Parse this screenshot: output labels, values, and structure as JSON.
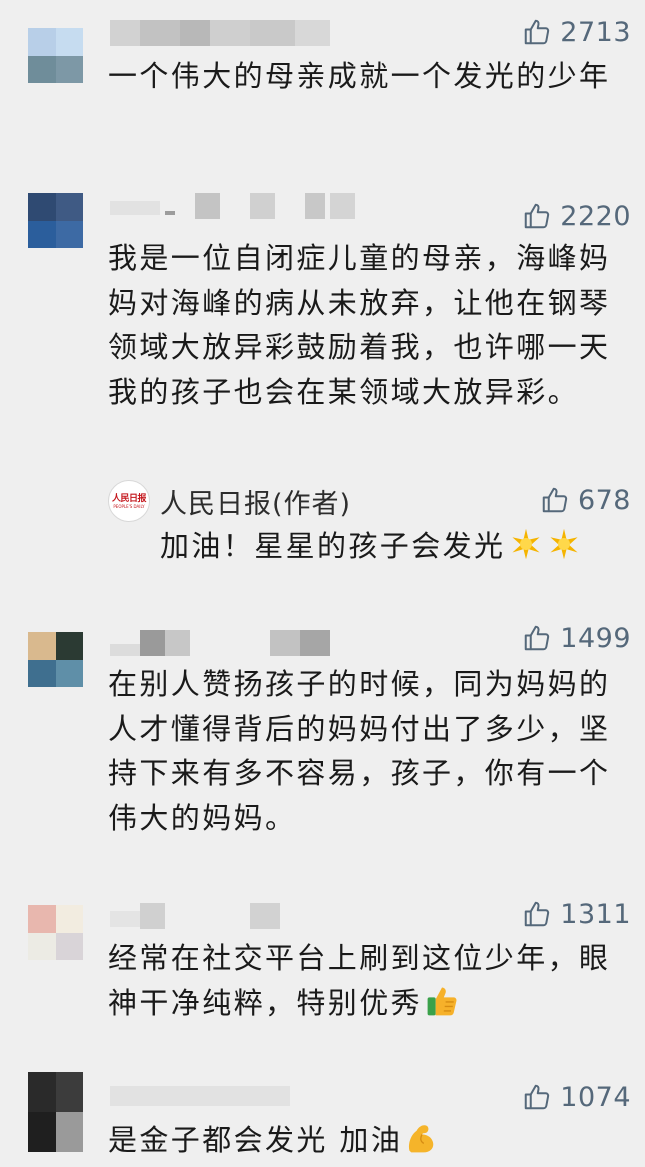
{
  "comments": [
    {
      "likes": "2713",
      "text": "一个伟大的母亲成就一个发光的少年",
      "avatar_colors": [
        "#b8cfe8",
        "#c6dcf0",
        "#6f8d9a",
        "#7d98a6"
      ]
    },
    {
      "likes": "2220",
      "text": "我是一位自闭症儿童的母亲，海峰妈妈对海峰的病从未放弃，让他在钢琴领域大放异彩鼓励着我，也许哪一天我的孩子也会在某领域大放异彩。",
      "avatar_colors": [
        "#2f4a72",
        "#3f5a84",
        "#2b5e9c",
        "#3d6aa4"
      ],
      "reply": {
        "author": "人民日报(作者)",
        "logo_text": "人民日报",
        "logo_subtext": "PEOPLE'S DAILY",
        "likes": "678",
        "text": "加油！星星的孩子会发光",
        "emoji": [
          "star-icon",
          "star-icon"
        ]
      }
    },
    {
      "likes": "1499",
      "text": "在别人赞扬孩子的时候，同为妈妈的人才懂得背后的妈妈付出了多少，坚持下来有多不容易，孩子，你有一个伟大的妈妈。",
      "avatar_colors": [
        "#d9b98e",
        "#2b3a33",
        "#3f6f8f",
        "#5f8fa8"
      ]
    },
    {
      "likes": "1311",
      "text": "经常在社交平台上刷到这位少年，眼神干净纯粹，特别优秀",
      "emoji": "thumbs-up-icon",
      "avatar_colors": [
        "#e8b7ae",
        "#f2ece0",
        "#ecebe4",
        "#d9d4d8"
      ]
    },
    {
      "likes": "1074",
      "text": "是金子都会发光 加油",
      "emoji": "flexed-biceps-icon",
      "avatar_colors": [
        "#2a2a2a",
        "#3c3c3c",
        "#1f1f1f",
        "#9a9a9a"
      ]
    }
  ],
  "colors": {
    "background": "#efefef",
    "like_color": "#55687a",
    "text": "#1a1a1a"
  }
}
